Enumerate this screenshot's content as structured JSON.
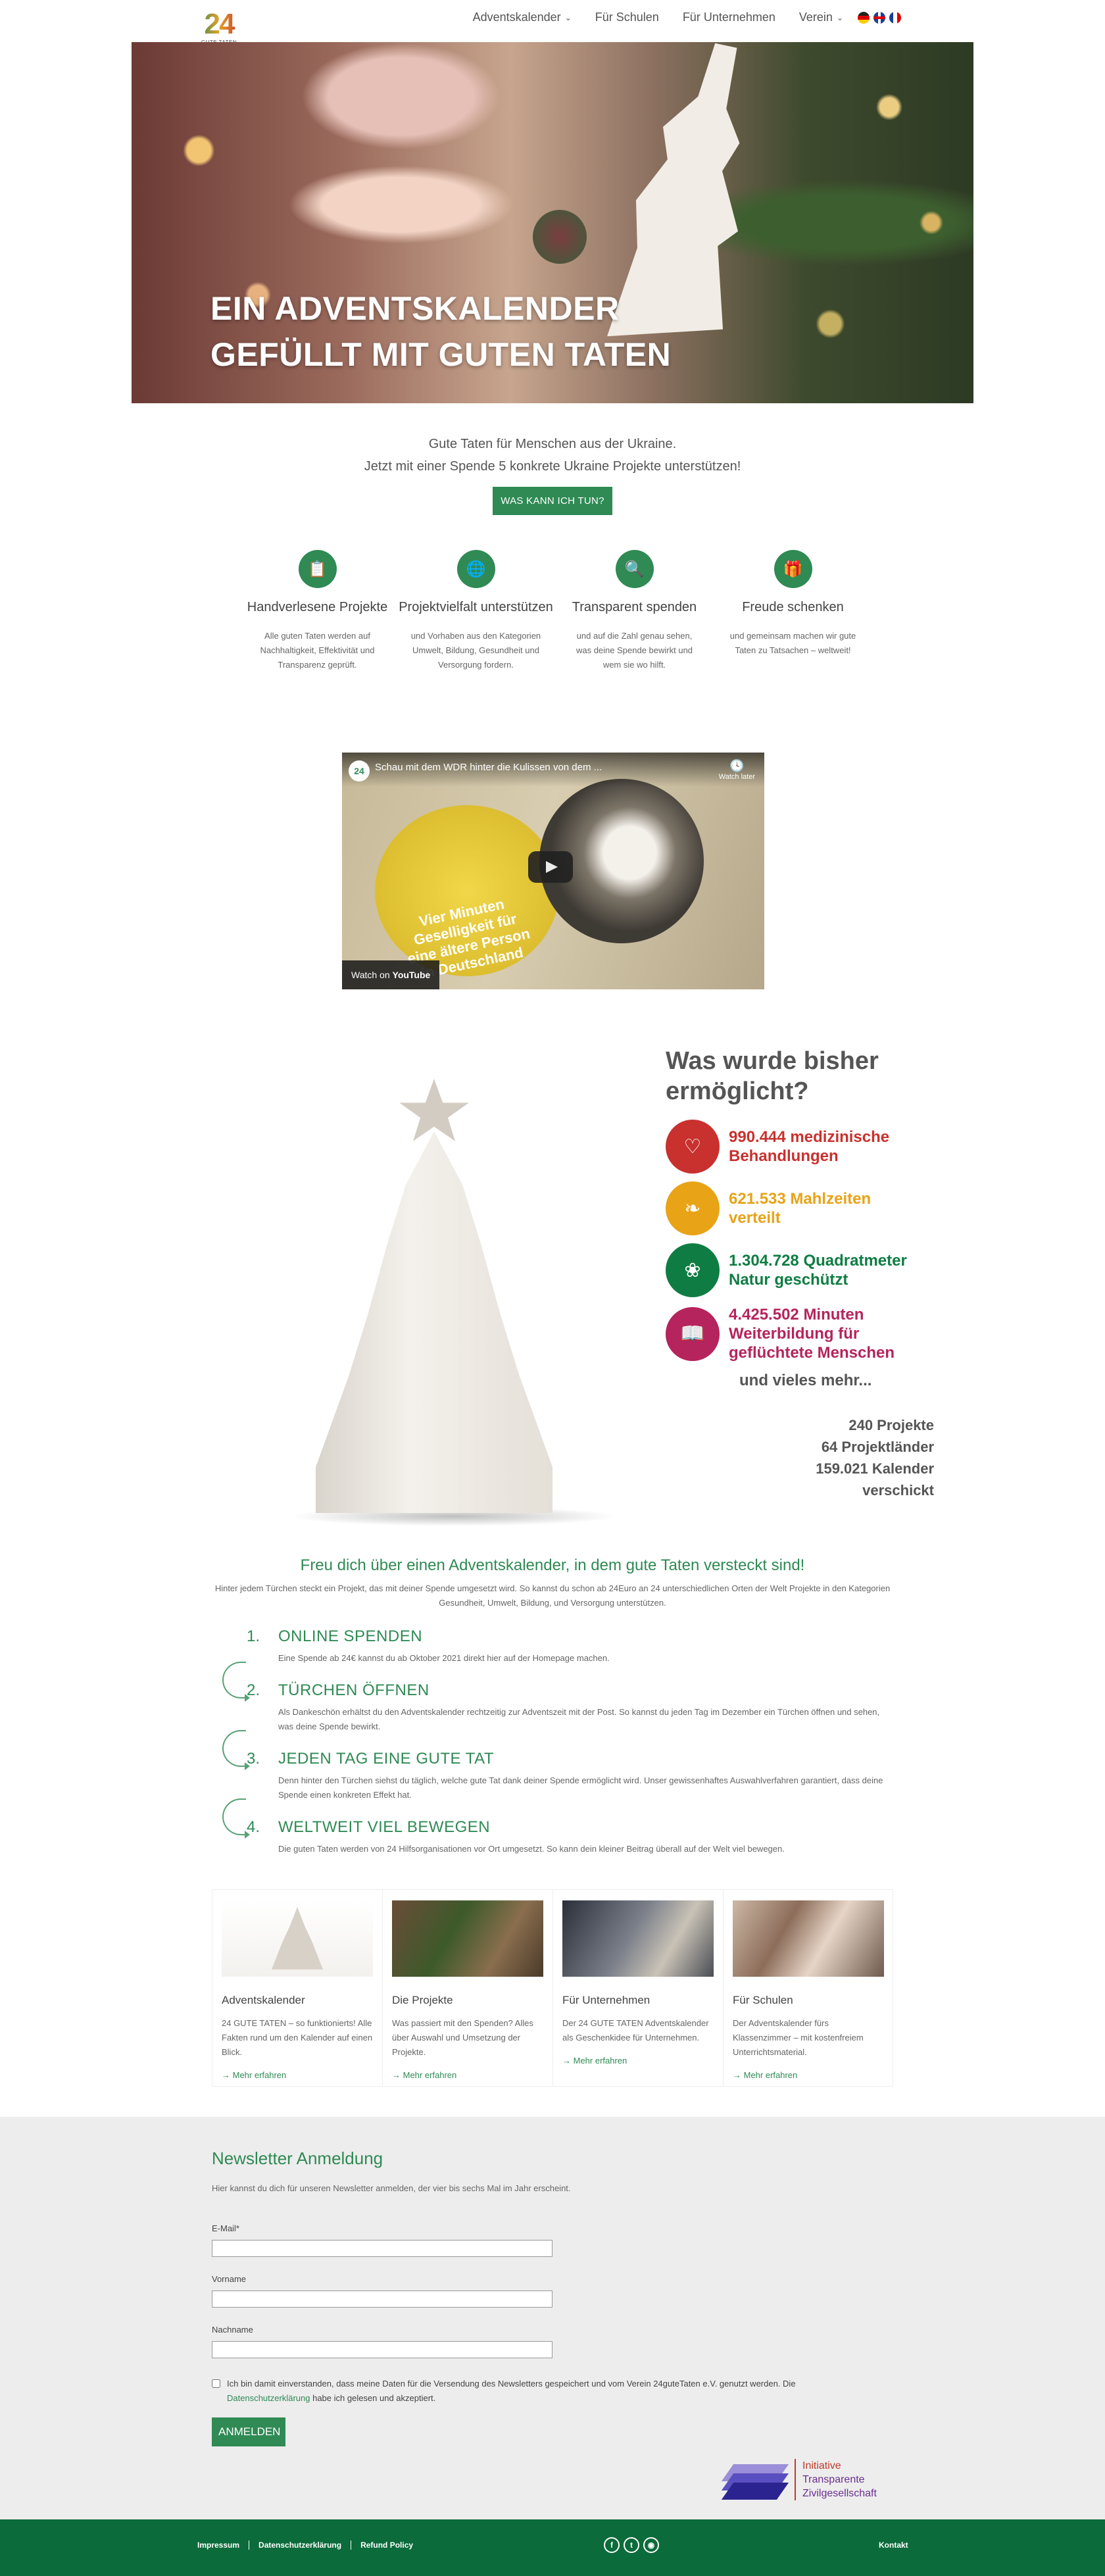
{
  "header": {
    "logo_number": "24",
    "logo_sub": "GUTE TATEN",
    "nav": [
      {
        "label": "Adventskalender",
        "has_dropdown": true
      },
      {
        "label": "Für Schulen",
        "has_dropdown": false
      },
      {
        "label": "Für Unternehmen",
        "has_dropdown": false
      },
      {
        "label": "Verein",
        "has_dropdown": true
      }
    ],
    "languages": [
      "de",
      "en",
      "fr"
    ]
  },
  "hero": {
    "line1": "EIN ADVENTSKALENDER",
    "line2": "GEFÜLLT MIT GUTEN TATEN"
  },
  "intro": {
    "line1": "Gute Taten für Menschen aus der Ukraine.",
    "line2": "Jetzt mit einer Spende 5 konkrete Ukraine Projekte unterstützen!",
    "cta": "WAS KANN ICH TUN?"
  },
  "features": [
    {
      "icon": "document-check-icon",
      "title": "Handverlesene Projekte",
      "text": "Alle guten Taten werden auf Nachhaltigkeit, Effektivität und Transparenz geprüft."
    },
    {
      "icon": "globe-hands-icon",
      "title": "Projektvielfalt unterstützen",
      "text": "und Vorhaben aus den Kategorien Umwelt, Bildung, Gesundheit und Versorgung fordern."
    },
    {
      "icon": "magnifier-icon",
      "title": "Transparent spenden",
      "text": "und auf die Zahl genau sehen, was deine Spende bewirkt und wem sie wo hilft."
    },
    {
      "icon": "gift-icon",
      "title": "Freude schenken",
      "text": "und gemeinsam machen wir gute Taten zu Tatsachen – weltweit!"
    }
  ],
  "video": {
    "title": "Schau mit dem WDR hinter die Kulissen von dem ...",
    "watch_later": "Watch later",
    "coin_text": "Vier Minuten Geselligkeit für eine ältere Person in Deutschland",
    "watch_on": "Watch on",
    "platform": "YouTube"
  },
  "stats": {
    "heading_line1": "Was wurde bisher",
    "heading_line2": "ermöglicht?",
    "items": [
      {
        "icon": "heart-icon",
        "color": "#c8312e",
        "line1": "990.444 medizinische",
        "line2": "Behandlungen"
      },
      {
        "icon": "bread-icon",
        "color": "#e8a317",
        "line1": "621.533 Mahlzeiten",
        "line2": "verteilt"
      },
      {
        "icon": "sprout-icon",
        "color": "#0f7d43",
        "line1": "1.304.728 Quadratmeter",
        "line2": "Natur geschützt"
      },
      {
        "icon": "book-icon",
        "color": "#b5245c",
        "line1": "4.425.502 Minuten",
        "line2": "Weiterbildung für geflüchtete Menschen"
      }
    ],
    "more": "und vieles mehr...",
    "totals": [
      "240 Projekte",
      "64 Projektländer",
      "159.021 Kalender",
      "verschickt"
    ]
  },
  "steps": {
    "title": "Freu dich über einen Adventskalender, in dem gute Taten versteckt sind!",
    "intro": "Hinter jedem Türchen steckt ein Projekt, das mit deiner Spende umgesetzt wird. So kannst du schon ab 24Euro an 24 unterschiedlichen Orten der Welt Projekte in den Kategorien Gesundheit, Umwelt, Bildung, und Versorgung unterstützen.",
    "items": [
      {
        "num": "1.",
        "title": "ONLINE SPENDEN",
        "text": "Eine Spende ab 24€ kannst du ab Oktober 2021 direkt hier auf der Homepage machen."
      },
      {
        "num": "2.",
        "title": "TÜRCHEN ÖFFNEN",
        "text": "Als Dankeschön erhältst du den Adventskalender rechtzeitig zur Adventszeit mit der Post. So kannst du jeden Tag im Dezember ein Türchen öffnen und sehen, was deine Spende bewirkt."
      },
      {
        "num": "3.",
        "title": "JEDEN TAG EINE GUTE TAT",
        "text": "Denn hinter den Türchen siehst du täglich, welche gute Tat dank deiner Spende ermöglicht wird. Unser gewissenhaftes Auswahlverfahren garantiert, dass deine Spende einen konkreten Effekt hat."
      },
      {
        "num": "4.",
        "title": "WELTWEIT VIEL BEWEGEN",
        "text": "Die guten Taten werden von 24 Hilfsorganisationen vor Ort umgesetzt. So kann dein kleiner Beitrag überall auf der Welt viel bewegen."
      }
    ]
  },
  "cards": [
    {
      "title": "Adventskalender",
      "text": "24 GUTE TATEN – so funktionierts! Alle Fakten rund um den Kalender auf einen Blick.",
      "link": "→ Mehr erfahren"
    },
    {
      "title": "Die Projekte",
      "text": "Was passiert mit den Spenden? Alles über Auswahl und Umsetzung der Projekte.",
      "link": "→ Mehr erfahren"
    },
    {
      "title": "Für Unternehmen",
      "text": "Der 24 GUTE TATEN Adventskalender als Geschenkidee für Unternehmen.",
      "link": "→ Mehr erfahren"
    },
    {
      "title": "Für Schulen",
      "text": "Der Adventskalender fürs Klassenzimmer – mit kostenfreiem Unterrichtsmaterial.",
      "link": "→ Mehr erfahren"
    }
  ],
  "newsletter": {
    "title": "Newsletter Anmeldung",
    "desc": "Hier kannst du dich für unseren Newsletter anmelden, der vier bis sechs Mal im Jahr erscheint.",
    "email_label": "E-Mail*",
    "email_value": "",
    "firstname_label": "Vorname",
    "firstname_value": "",
    "lastname_label": "Nachname",
    "lastname_value": "",
    "consent_text1": "Ich bin damit einverstanden, dass meine Daten für die Versendung des Newsletters gespeichert und vom Verein 24guteTaten e.V. genutzt werden. Die",
    "consent_link": "Datenschutzerklärung",
    "consent_text2": "habe ich gelesen und akzeptiert.",
    "submit": "ANMELDEN"
  },
  "itz": {
    "line1": "Initiative",
    "line2": "Transparente",
    "line3": "Zivilgesellschaft"
  },
  "footer": {
    "links": [
      "Impressum",
      "Datenschutzerklärung",
      "Refund Policy"
    ],
    "social": [
      "facebook-icon",
      "twitter-icon",
      "instagram-icon"
    ],
    "kontakt": "Kontakt"
  },
  "colors": {
    "brand_green": "#2f8a54",
    "footer_green": "#0b6b3a",
    "red": "#c8312e",
    "yellow": "#e8a317",
    "green": "#0f7d43",
    "magenta": "#b5245c"
  }
}
